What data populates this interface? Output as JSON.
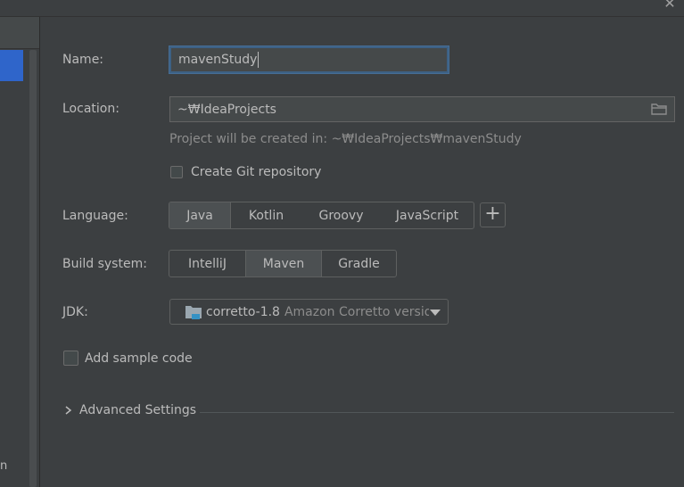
{
  "dialog": {
    "close_glyph": "✕"
  },
  "sidebar": {
    "partial_text": "n"
  },
  "form": {
    "name": {
      "label": "Name:",
      "value": "mavenStudy"
    },
    "location": {
      "label": "Location:",
      "value": "~₩IdeaProjects"
    },
    "hint": "Project will be created in: ~₩IdeaProjects₩mavenStudy",
    "git": {
      "label": "Create Git repository",
      "checked": false
    },
    "language": {
      "label": "Language:",
      "options": [
        "Java",
        "Kotlin",
        "Groovy",
        "JavaScript"
      ],
      "selected": "Java",
      "add_glyph": "+"
    },
    "build_system": {
      "label": "Build system:",
      "options": [
        "IntelliJ",
        "Maven",
        "Gradle"
      ],
      "selected": "Maven"
    },
    "jdk": {
      "label": "JDK:",
      "name": "corretto-1.8",
      "description": "Amazon Corretto versio"
    },
    "sample_code": {
      "label": "Add sample code",
      "checked": false
    },
    "advanced": {
      "label": "Advanced Settings"
    }
  },
  "icons": {
    "close": "close-icon",
    "folder": "folder-icon",
    "jdk": "jdk-folder-icon",
    "dropdown": "dropdown-arrow-icon",
    "chevron": "chevron-right-icon",
    "plus": "plus-icon"
  },
  "colors": {
    "background": "#3c3f41",
    "selection_blue": "#2f65ca",
    "focus_border": "#3d6185",
    "jdk_icon_accent": "#3592c4"
  }
}
